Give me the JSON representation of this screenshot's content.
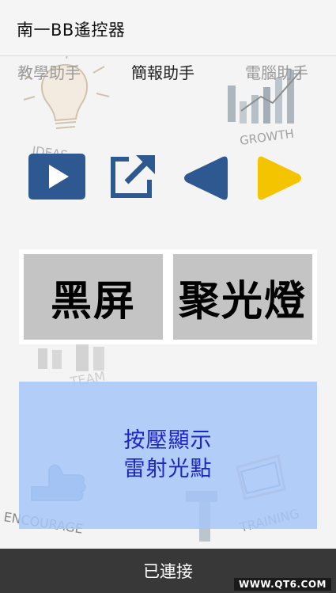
{
  "app": {
    "title": "南一BB遙控器"
  },
  "tabs": [
    {
      "label": "教學助手"
    },
    {
      "label": "簡報助手"
    },
    {
      "label": "電腦助手"
    }
  ],
  "controls": {
    "play_icon": "play-icon",
    "open_icon": "open-external-icon",
    "prev_icon": "previous-arrow-icon",
    "next_icon": "next-arrow-icon"
  },
  "buttons": {
    "black_screen": "黑屏",
    "spotlight": "聚光燈",
    "laser_line1": "按壓顯示",
    "laser_line2": "雷射光點"
  },
  "background_art": {
    "idea": "IDEAS",
    "growth": "GROWTH",
    "team": "TEAM",
    "encourage": "ENCOURAGE",
    "training": "TRAINING"
  },
  "status": {
    "text": "已連接"
  },
  "watermark": {
    "text": "WWW.QT6.COM"
  },
  "colors": {
    "accent_blue": "#2d5990",
    "accent_yellow": "#f5c400",
    "laser_bg": "#a6c6f8",
    "laser_text": "#1d23c8",
    "status_bg": "#383838",
    "button_grey": "#c4c4c4"
  }
}
